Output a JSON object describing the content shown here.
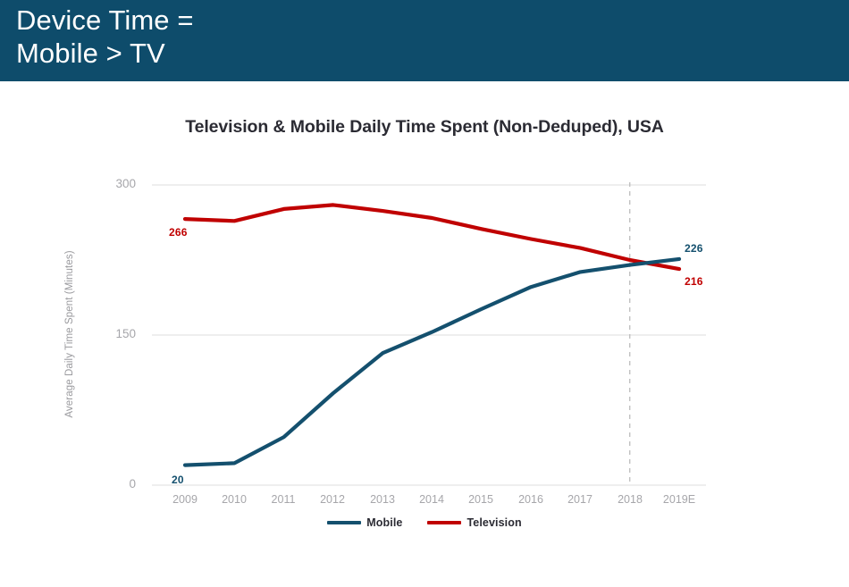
{
  "banner": {
    "title": "Device Time =\nMobile > TV",
    "background_color": "#0e4c6b",
    "text_color": "#ffffff"
  },
  "chart_data": {
    "type": "line",
    "title": "Television & Mobile Daily Time Spent (Non-Deduped), USA",
    "xlabel": "",
    "ylabel": "Average Daily Time Spent (Minutes)",
    "categories": [
      "2009",
      "2010",
      "2011",
      "2012",
      "2013",
      "2014",
      "2015",
      "2016",
      "2017",
      "2018",
      "2019E"
    ],
    "ylim": [
      0,
      300
    ],
    "yticks": [
      0,
      150,
      300
    ],
    "ytick_labels": [
      "0",
      "150",
      "300"
    ],
    "grid": "horizontal",
    "legend_position": "bottom-center",
    "series": [
      {
        "name": "Mobile",
        "color": "#14506e",
        "values": [
          20,
          22,
          48,
          92,
          132,
          153,
          176,
          198,
          213,
          220,
          226
        ]
      },
      {
        "name": "Television",
        "color": "#c00000",
        "values": [
          266,
          264,
          276,
          280,
          274,
          267,
          256,
          246,
          237,
          225,
          216
        ]
      }
    ],
    "annotations": [
      {
        "text": "266",
        "series": "Television",
        "category": "2009",
        "color": "#c00000"
      },
      {
        "text": "20",
        "series": "Mobile",
        "category": "2009",
        "color": "#14506e"
      },
      {
        "text": "226",
        "series": "Mobile",
        "category": "2019E",
        "color": "#14506e"
      },
      {
        "text": "216",
        "series": "Television",
        "category": "2019E",
        "color": "#c00000"
      }
    ],
    "reference_line": {
      "category": "2018",
      "style": "dashed",
      "color": "#bdbdbd"
    }
  },
  "labels": {
    "y_0": "0",
    "y_150": "150",
    "y_300": "300",
    "x_2009": "2009",
    "x_2010": "2010",
    "x_2011": "2011",
    "x_2012": "2012",
    "x_2013": "2013",
    "x_2014": "2014",
    "x_2015": "2015",
    "x_2016": "2016",
    "x_2017": "2017",
    "x_2018": "2018",
    "x_2019E": "2019E",
    "ann_266": "266",
    "ann_20": "20",
    "ann_226": "226",
    "ann_216": "216",
    "legend_mobile": "Mobile",
    "legend_television": "Television"
  }
}
